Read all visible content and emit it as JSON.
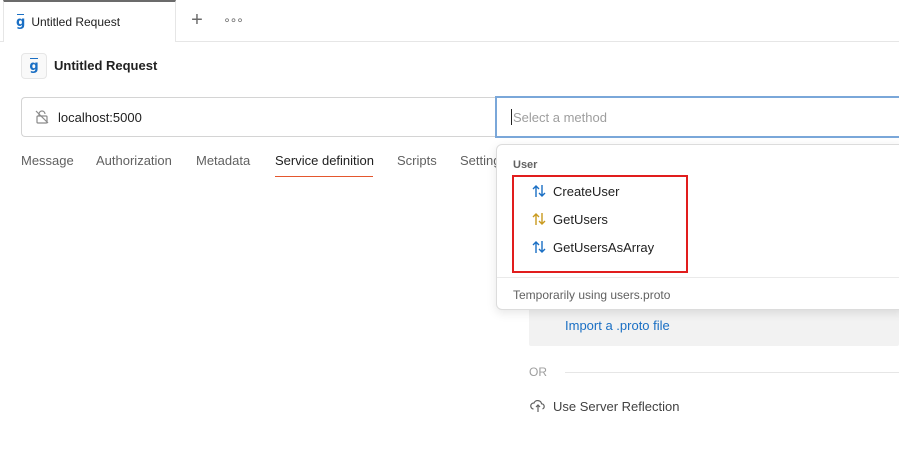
{
  "tabbar": {
    "tab_label": "Untitled Request",
    "add_label": "+",
    "more_label": "∘∘∘"
  },
  "request": {
    "title": "Untitled Request"
  },
  "url": {
    "value": "localhost:5000"
  },
  "method": {
    "placeholder": "Select a method"
  },
  "subtabs": [
    {
      "label": "Message"
    },
    {
      "label": "Authorization"
    },
    {
      "label": "Metadata"
    },
    {
      "label": "Service definition"
    },
    {
      "label": "Scripts"
    },
    {
      "label": "Settings"
    }
  ],
  "dropdown": {
    "group_label": "User",
    "items": [
      {
        "label": "CreateUser",
        "icon": "bidirectional-stream-icon",
        "color": "#1a6fc4"
      },
      {
        "label": "GetUsers",
        "icon": "server-stream-icon",
        "color": "#c99a1e"
      },
      {
        "label": "GetUsersAsArray",
        "icon": "bidirectional-stream-icon",
        "color": "#1a6fc4"
      }
    ],
    "footer": "Temporarily using users.proto"
  },
  "service_definition": {
    "import_label": "Import a .proto file",
    "or_label": "OR",
    "reflection_label": "Use Server Reflection"
  },
  "colors": {
    "accent": "#e4572e",
    "link": "#1a6fc4",
    "focus_border": "#7aa7d9",
    "highlight": "#e11d1d"
  }
}
